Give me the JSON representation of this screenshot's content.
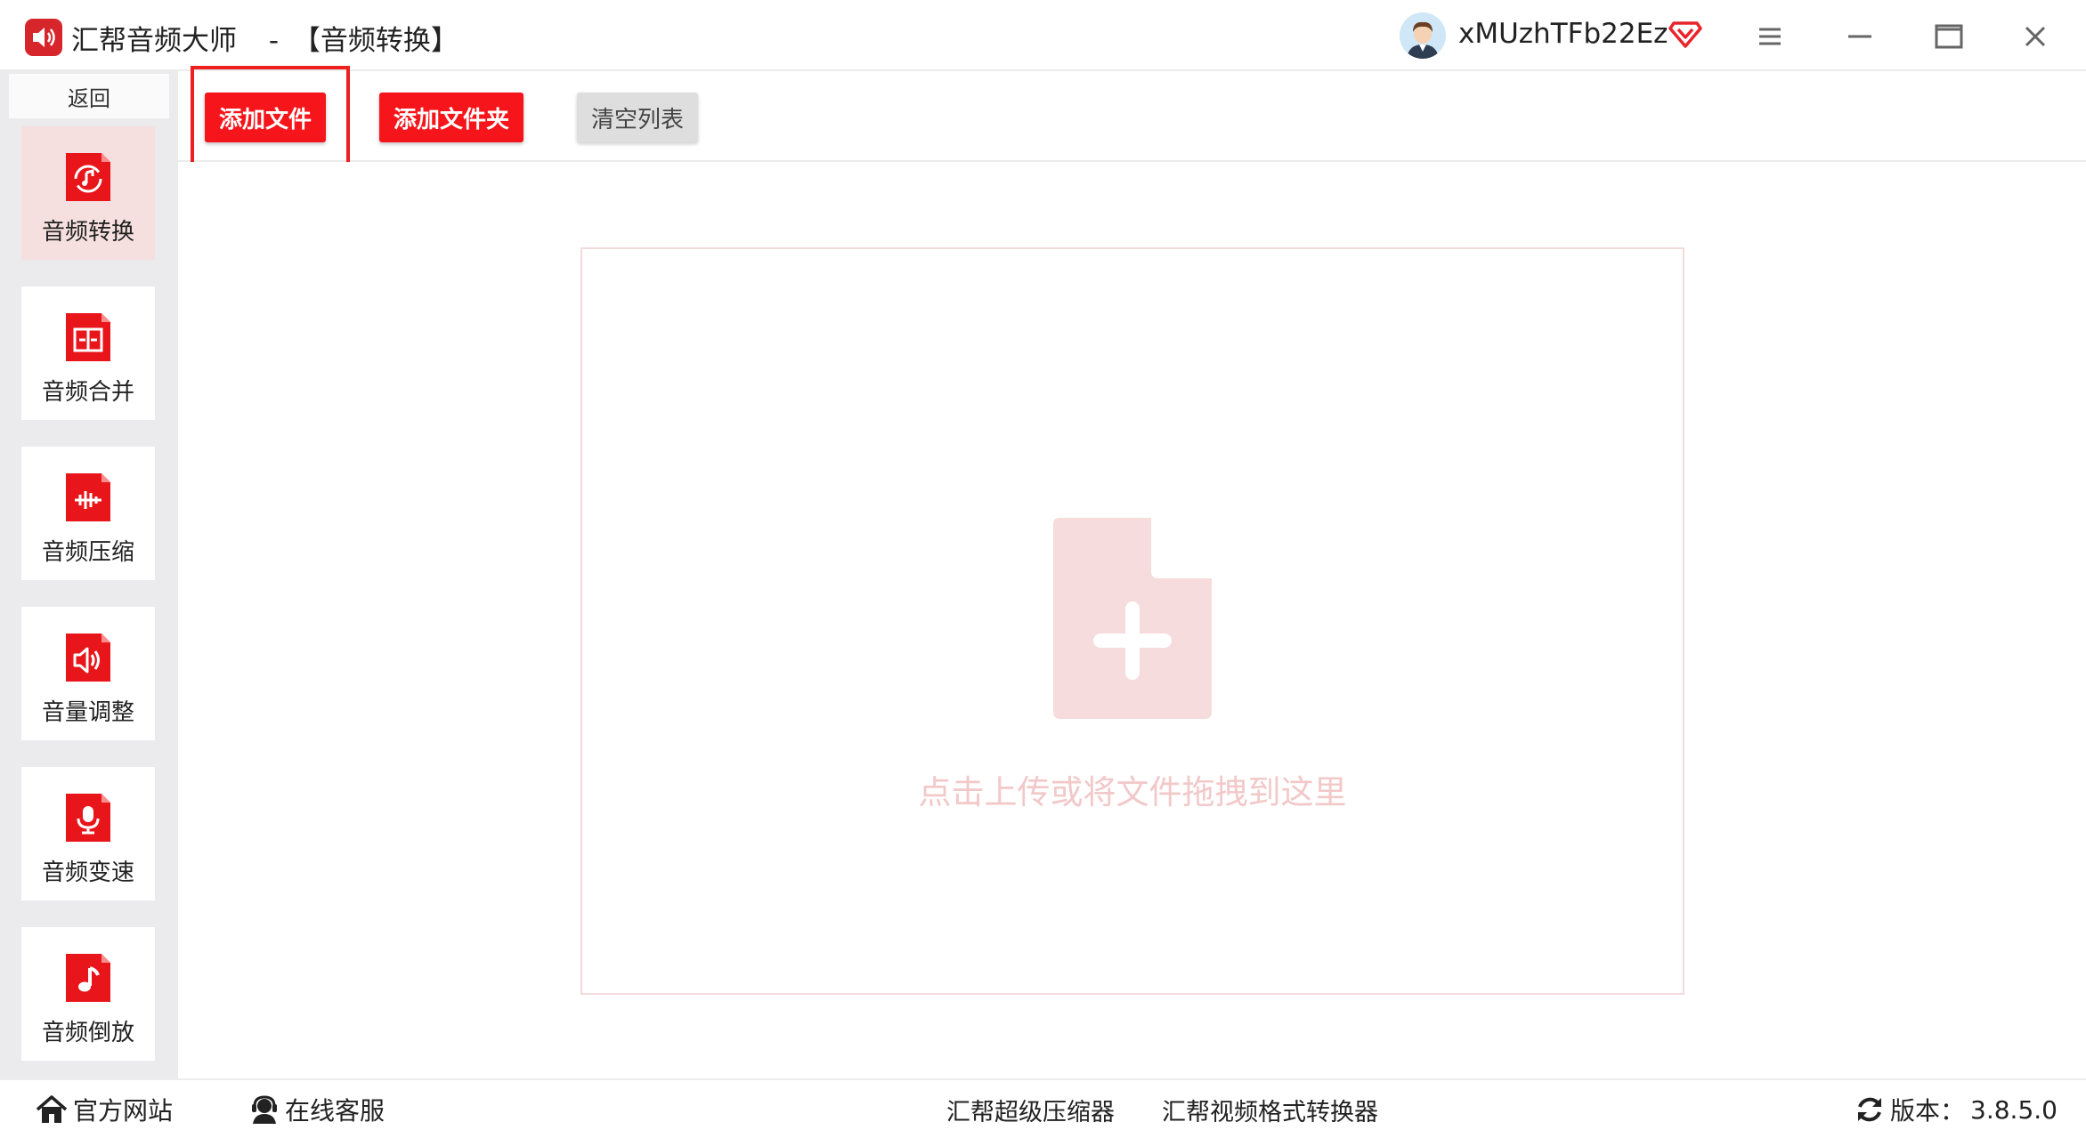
{
  "window": {
    "app_name": "汇帮音频大师",
    "separator": "-",
    "section": "【音频转换】",
    "username": "xMUzhTFb22Ez"
  },
  "sidebar": {
    "back_label": "返回",
    "items": [
      {
        "label": "音频转换",
        "icon": "audio-convert-icon",
        "active": true
      },
      {
        "label": "音频合并",
        "icon": "audio-merge-icon",
        "active": false
      },
      {
        "label": "音频压缩",
        "icon": "audio-compress-icon",
        "active": false
      },
      {
        "label": "音量调整",
        "icon": "volume-adjust-icon",
        "active": false
      },
      {
        "label": "音频变速",
        "icon": "audio-speed-icon",
        "active": false
      },
      {
        "label": "音频倒放",
        "icon": "audio-reverse-icon",
        "active": false
      }
    ]
  },
  "toolbar": {
    "add_file": "添加文件",
    "add_folder": "添加文件夹",
    "clear_list": "清空列表"
  },
  "dropzone": {
    "hint": "点击上传或将文件拖拽到这里"
  },
  "footer": {
    "website": "官方网站",
    "support": "在线客服",
    "link_compressor": "汇帮超级压缩器",
    "link_video_converter": "汇帮视频格式转换器",
    "version_label": "版本：",
    "version_value": "3.8.5.0"
  },
  "colors": {
    "accent": "#f5151b",
    "active_nav_bg": "#f6dfdf",
    "dropzone_icon": "#f6dcdc",
    "dropzone_text": "#f2c8c9"
  }
}
